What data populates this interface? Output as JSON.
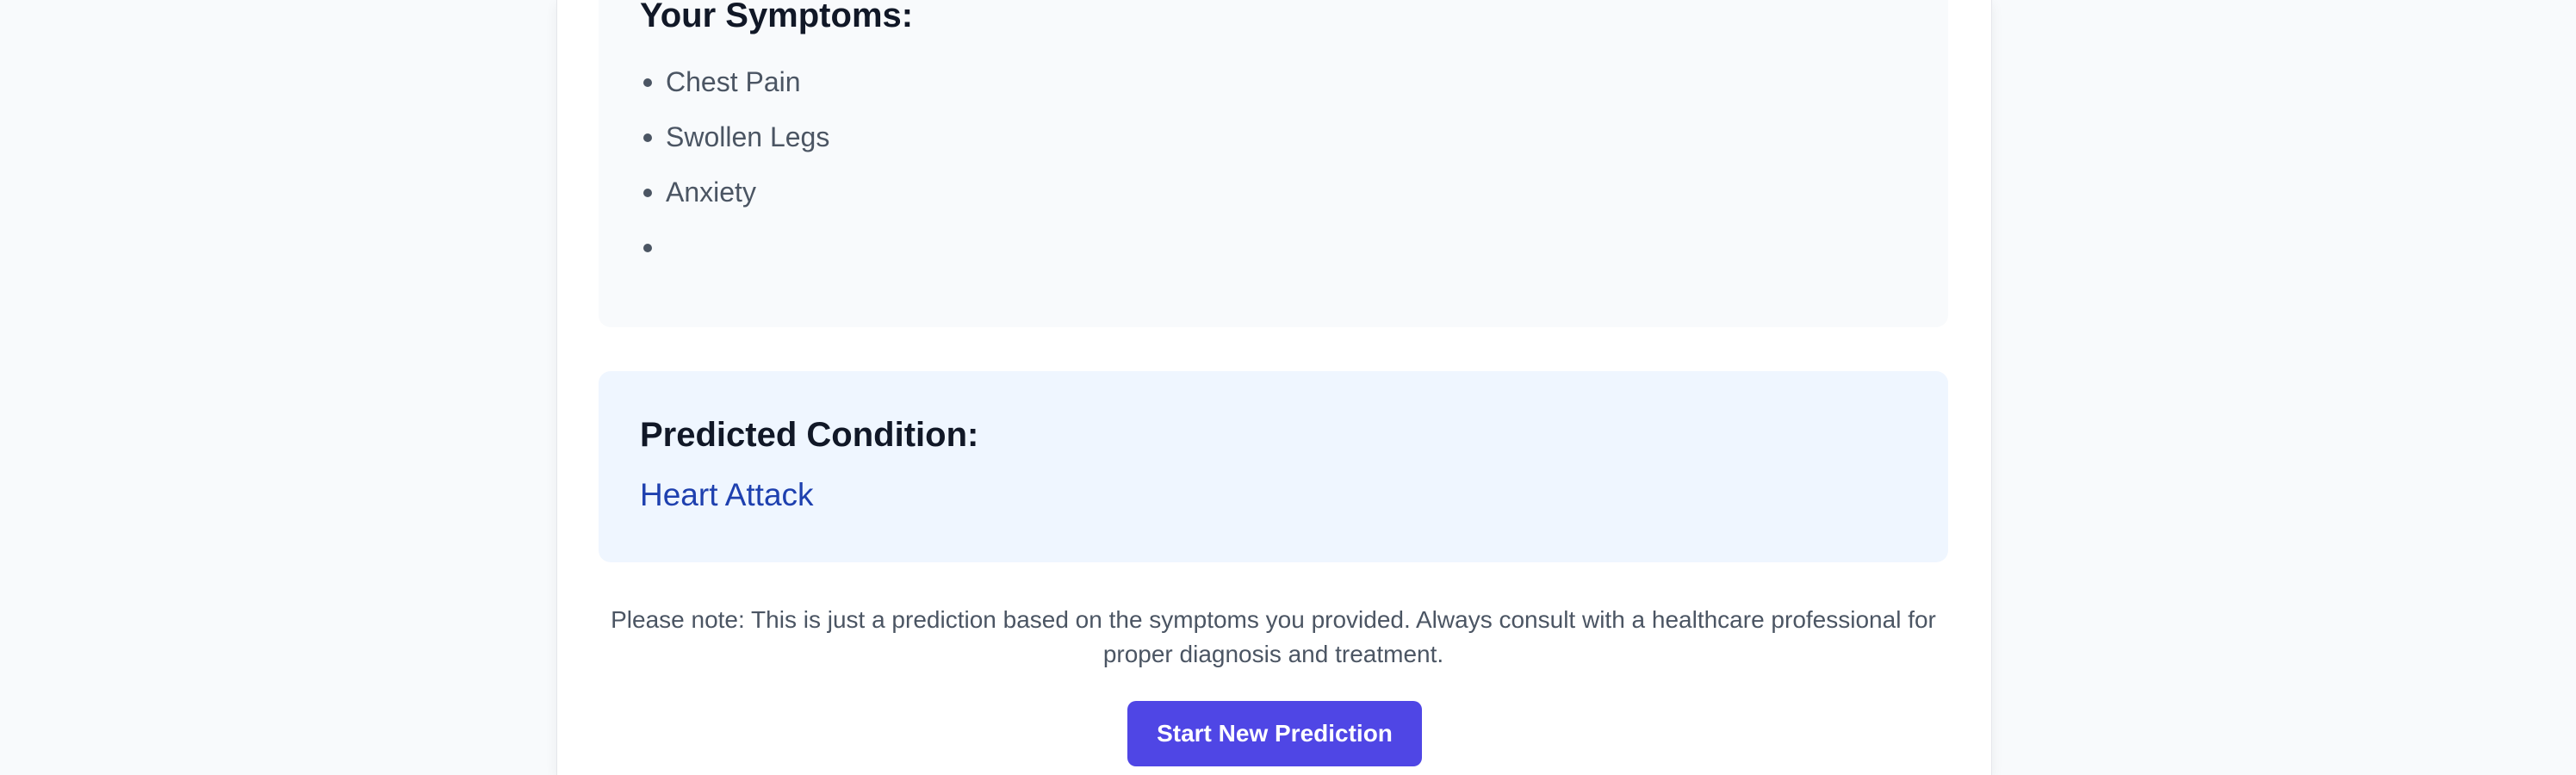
{
  "symptoms": {
    "title": "Your Symptoms:",
    "items": [
      {
        "label": "Chest Pain"
      },
      {
        "label": "Swollen Legs"
      },
      {
        "label": "Anxiety"
      },
      {
        "label": ""
      }
    ]
  },
  "prediction": {
    "title": "Predicted Condition:",
    "condition": "Heart Attack"
  },
  "note": "Please note: This is just a prediction based on the symptoms you provided. Always consult with a healthcare professional for proper diagnosis and treatment.",
  "actions": {
    "new_prediction_label": "Start New Prediction"
  },
  "colors": {
    "page_background": "#f8fafc",
    "card_background": "#ffffff",
    "symptoms_box": "#f8fafc",
    "prediction_box": "#eff6ff",
    "condition_text": "#1e40af",
    "button_accent": "#4f46e5"
  }
}
